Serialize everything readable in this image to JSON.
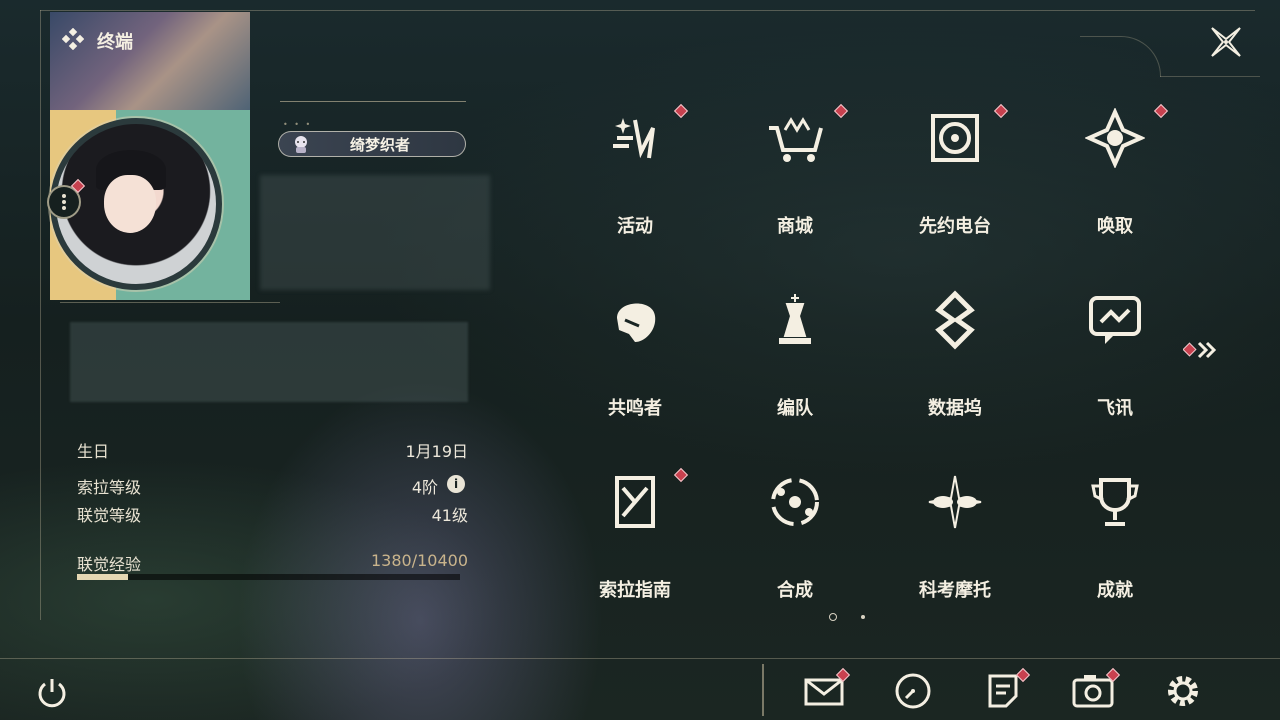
{
  "header": {
    "title": "终端",
    "logo_icon": "diamond-cluster-icon",
    "close_icon": "close-icon"
  },
  "profile": {
    "title_badge": "绮梦织者",
    "avatar": "player-avatar",
    "more_icon": "more-vertical-icon",
    "stats": [
      {
        "label": "生日",
        "value": "1月19日"
      },
      {
        "label": "索拉等级",
        "value": "4阶"
      },
      {
        "label": "联觉等级",
        "value": "41级"
      }
    ],
    "info_icon": "i",
    "exp": {
      "label": "联觉经验",
      "value": "1380/10400",
      "progress": 0.133
    }
  },
  "menu": {
    "items": [
      {
        "label": "活动",
        "icon": "event-spark-icon",
        "badge": true
      },
      {
        "label": "商城",
        "icon": "shop-cart-icon",
        "badge": true
      },
      {
        "label": "先约电台",
        "icon": "radio-record-icon",
        "badge": true
      },
      {
        "label": "唤取",
        "icon": "summon-star-icon",
        "badge": true
      },
      {
        "label": "共鸣者",
        "icon": "resonator-head-icon",
        "badge": false
      },
      {
        "label": "编队",
        "icon": "chess-team-icon",
        "badge": false
      },
      {
        "label": "数据坞",
        "icon": "data-dock-icon",
        "badge": false
      },
      {
        "label": "飞讯",
        "icon": "message-chat-icon",
        "badge": false
      },
      {
        "label": "索拉指南",
        "icon": "guide-book-icon",
        "badge": true
      },
      {
        "label": "合成",
        "icon": "synthesis-orbit-icon",
        "badge": false
      },
      {
        "label": "科考摩托",
        "icon": "motorbike-icon",
        "badge": false
      },
      {
        "label": "成就",
        "icon": "trophy-icon",
        "badge": false
      }
    ],
    "next_page_icon": "double-chevron-right-icon",
    "page_index": 1,
    "page_count": 2
  },
  "bottom_bar": {
    "power_icon": "power-icon",
    "buttons": [
      {
        "icon": "mail-icon",
        "badge": true
      },
      {
        "icon": "clock-icon",
        "badge": false
      },
      {
        "icon": "notice-icon",
        "badge": true
      },
      {
        "icon": "camera-icon",
        "badge": true
      },
      {
        "icon": "settings-gear-icon",
        "badge": false
      }
    ]
  },
  "colors": {
    "accent_gold": "#c9b48c",
    "badge_red": "#c8414f",
    "text": "#f4efe2"
  }
}
